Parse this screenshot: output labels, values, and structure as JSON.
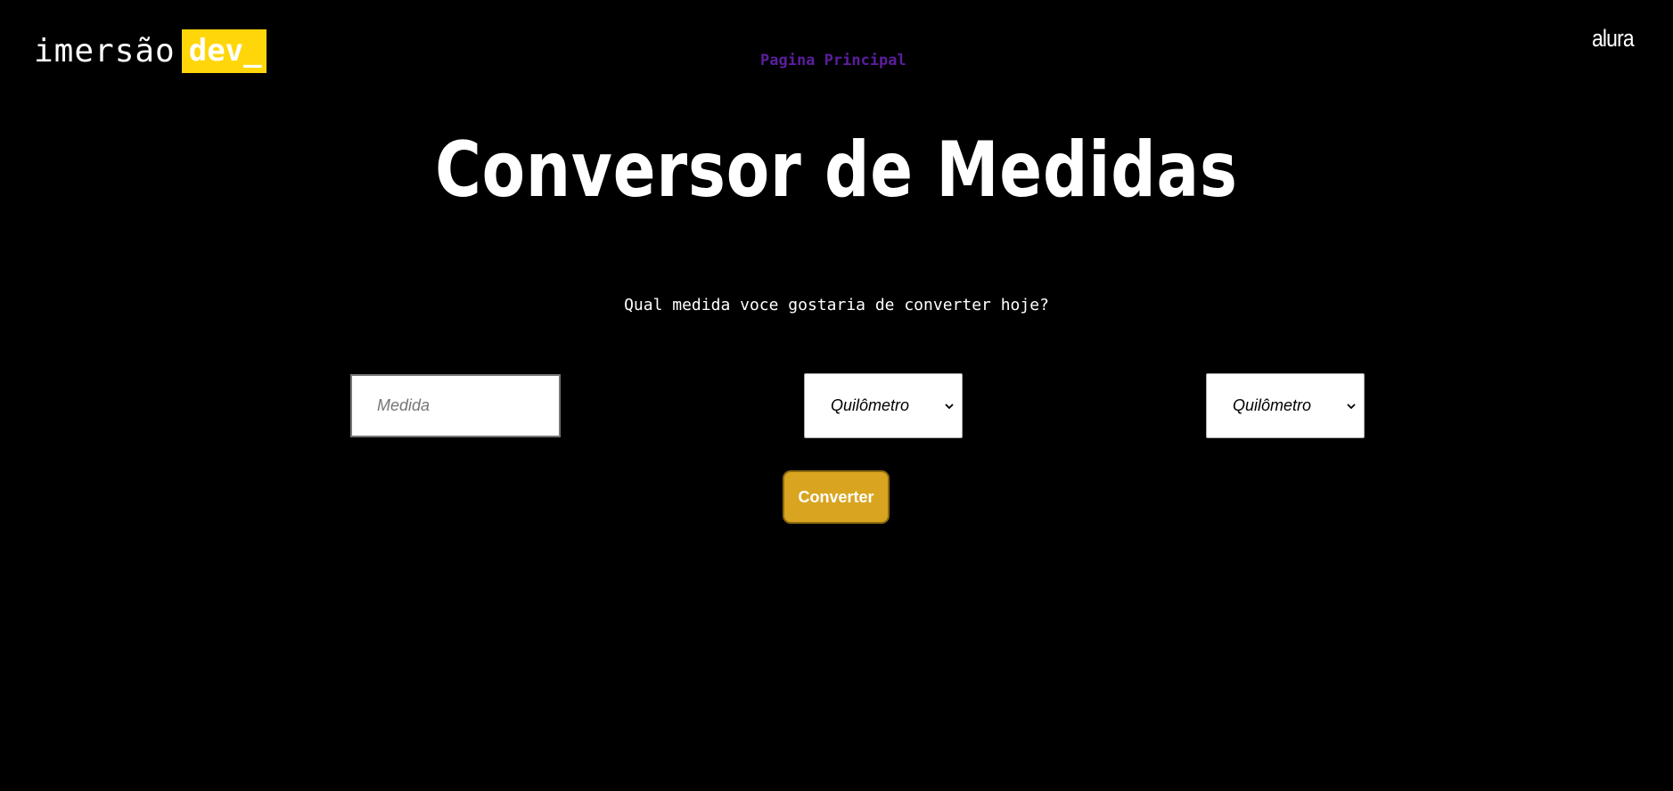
{
  "header": {
    "logo_text": "imersão",
    "logo_badge": "dev_",
    "nav_link": "Pagina Principal",
    "brand_right": "alura"
  },
  "main": {
    "title": "Conversor de Medidas",
    "question": "Qual medida voce gostaria de converter hoje?",
    "measure_input": {
      "placeholder": "Medida",
      "value": ""
    },
    "from_unit": {
      "selected": "Quilômetro"
    },
    "to_unit": {
      "selected": "Quilômetro"
    },
    "convert_label": "Converter"
  },
  "colors": {
    "background": "#000000",
    "badge_yellow": "#ffd60a",
    "nav_link_purple": "#5b1e9e",
    "button_gold": "#d9a520"
  },
  "icons": {
    "select_chevron": "chevron-down-icon"
  }
}
